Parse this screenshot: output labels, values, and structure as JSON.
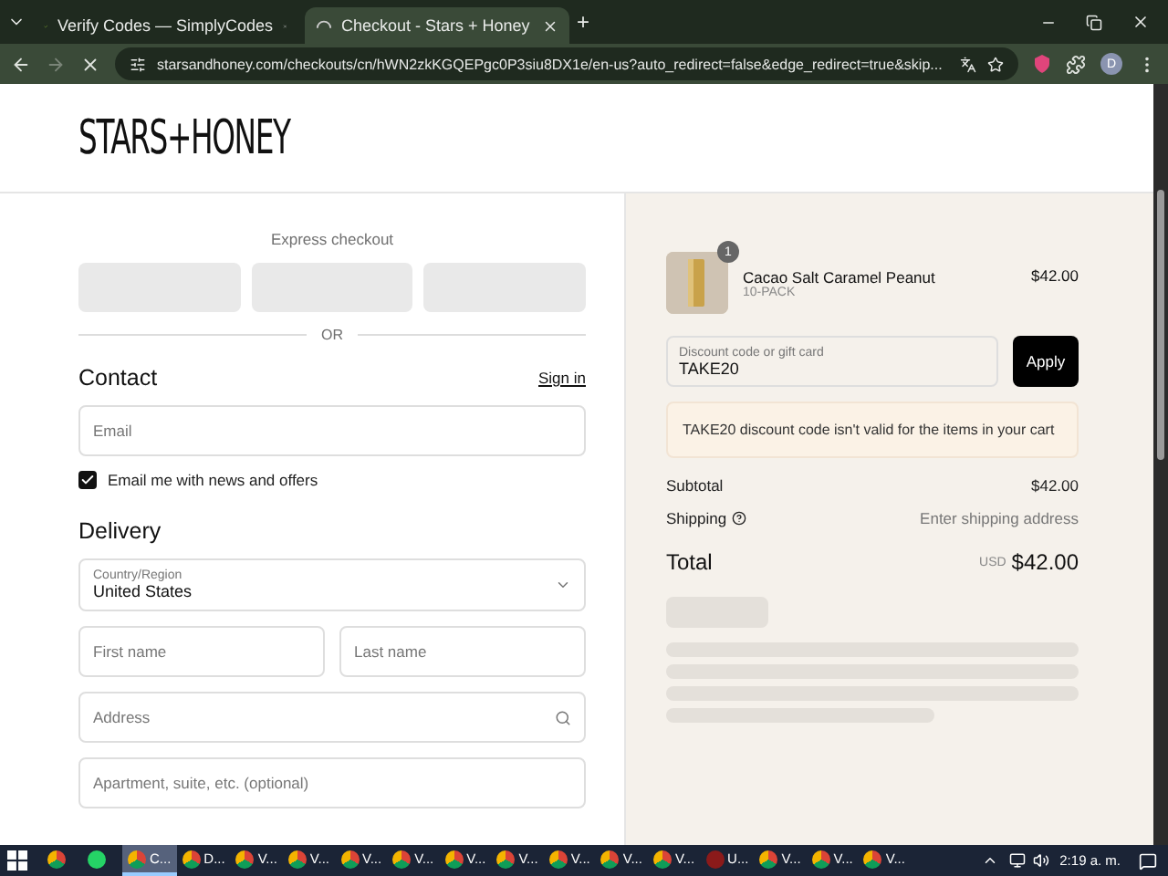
{
  "browser": {
    "tabs": [
      {
        "title": "Verify Codes — SimplyCodes",
        "selected": false,
        "kind": "check"
      },
      {
        "title": "Checkout - Stars + Honey",
        "selected": true,
        "kind": "loading"
      }
    ],
    "new_tab": "+",
    "url": "starsandhoney.com/checkouts/cn/hWN2zkKGQEPgc0P3siu8DX1e/en-us?auto_redirect=false&edge_redirect=true&skip...",
    "profile": "D"
  },
  "store": {
    "logo": "STARS+HONEY"
  },
  "express": {
    "title": "Express checkout",
    "or": "OR"
  },
  "contact": {
    "heading": "Contact",
    "sign_in": "Sign in",
    "email_placeholder": "Email",
    "newsletter": {
      "label": "Email me with news and offers",
      "checked": true
    }
  },
  "delivery": {
    "heading": "Delivery",
    "country_label": "Country/Region",
    "country": "United States",
    "first_name": "First name",
    "last_name": "Last name",
    "address": "Address",
    "apartment": "Apartment, suite, etc. (optional)"
  },
  "summary": {
    "item": {
      "name": "Cacao Salt Caramel Peanut",
      "variant": "10-PACK",
      "price": "$42.00",
      "quantity": "1"
    },
    "discount_label": "Discount code or gift card",
    "discount_value": "TAKE20",
    "apply": "Apply",
    "error": "TAKE20 discount code isn't valid for the items in your cart",
    "subtotal_label": "Subtotal",
    "subtotal": "$42.00",
    "shipping_label": "Shipping",
    "shipping": "Enter shipping address",
    "total_label": "Total",
    "currency": "USD",
    "total": "$42.00"
  },
  "taskbar": {
    "items": [
      {
        "kind": "chrome",
        "selected": false
      },
      {
        "kind": "whatsapp",
        "selected": false
      },
      {
        "label": "C...",
        "kind": "chrome",
        "selected": true
      },
      {
        "label": "D...",
        "kind": "chrome",
        "selected": false
      },
      {
        "label": "V...",
        "kind": "chrome",
        "selected": false
      },
      {
        "label": "V...",
        "kind": "chrome",
        "selected": false
      },
      {
        "label": "V...",
        "kind": "chrome",
        "selected": false
      },
      {
        "label": "V...",
        "kind": "chrome",
        "selected": false
      },
      {
        "label": "V...",
        "kind": "chrome",
        "selected": false
      },
      {
        "label": "V...",
        "kind": "chrome",
        "selected": false
      },
      {
        "label": "V...",
        "kind": "chrome",
        "selected": false
      },
      {
        "label": "V...",
        "kind": "chrome",
        "selected": false
      },
      {
        "label": "V...",
        "kind": "chrome",
        "selected": false
      },
      {
        "label": "U...",
        "kind": "app",
        "selected": false
      },
      {
        "label": "V...",
        "kind": "chrome",
        "selected": false
      },
      {
        "label": "V...",
        "kind": "chrome",
        "selected": false
      },
      {
        "label": "V...",
        "kind": "chrome",
        "selected": false
      }
    ],
    "time": "2:19 a. m."
  }
}
